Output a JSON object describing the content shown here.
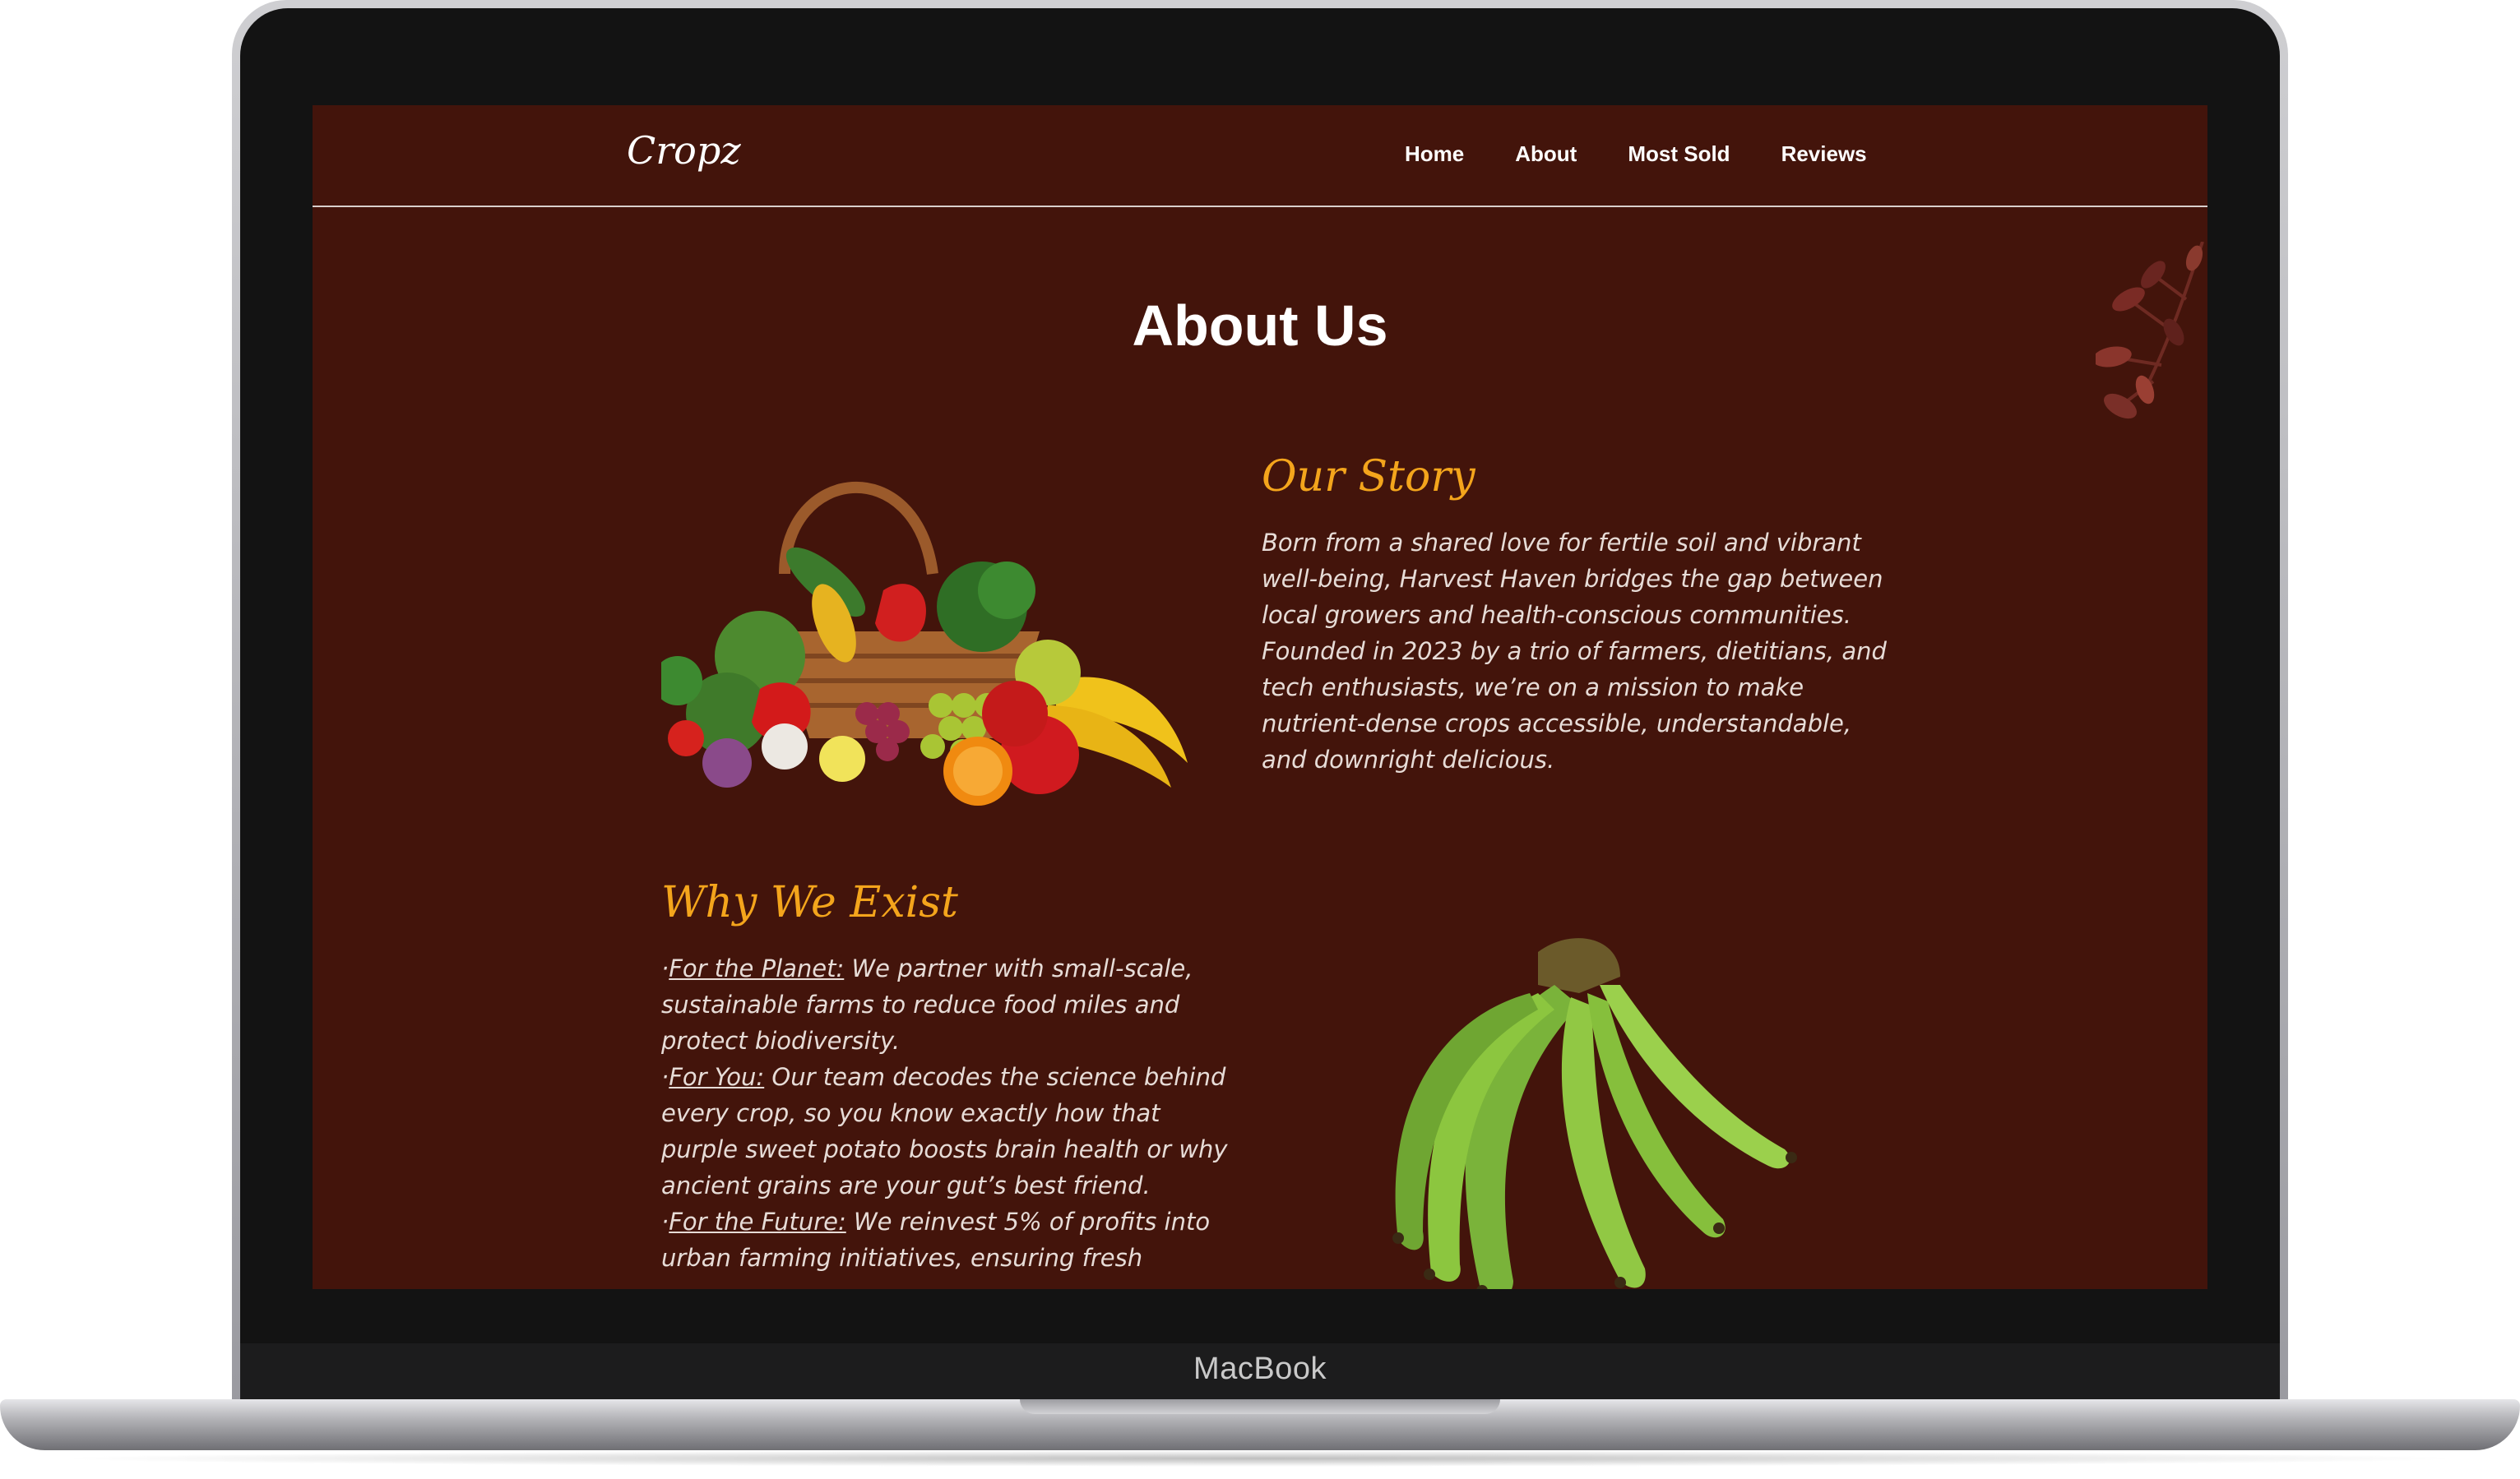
{
  "device": {
    "label": "MacBook"
  },
  "nav": {
    "brand": "Cropz",
    "links": [
      "Home",
      "About",
      "Most Sold",
      "Reviews"
    ]
  },
  "page": {
    "title": "About Us"
  },
  "story": {
    "heading": "Our Story",
    "text": "Born from a shared love for fertile soil and vibrant well-being, Harvest Haven bridges the gap between local growers and health-conscious communities. Founded in 2023 by a trio of farmers, dietitians, and tech enthusiasts, we’re on a mission to make nutrient-dense crops accessible, understandable, and downright delicious."
  },
  "why": {
    "heading": "Why We Exist",
    "items": [
      {
        "label": "For the Planet:",
        "text": " We partner with small-scale, sustainable farms to reduce food miles and protect biodiversity."
      },
      {
        "label": "For You:",
        "text": " Our team decodes the science behind every crop, so you know exactly how that purple sweet potato boosts brain health or why ancient grains are your gut’s best friend."
      },
      {
        "label": "For the Future:",
        "text": " We reinvest 5% of profits into urban farming initiatives, ensuring fresh"
      }
    ]
  },
  "images": {
    "basket": "vegetable-basket-image",
    "banana": "green-banana-image",
    "leaves": "decorative-leaves"
  },
  "colors": {
    "background": "#43140b",
    "accent": "#f4a51c",
    "text": "#e7dcd7"
  }
}
